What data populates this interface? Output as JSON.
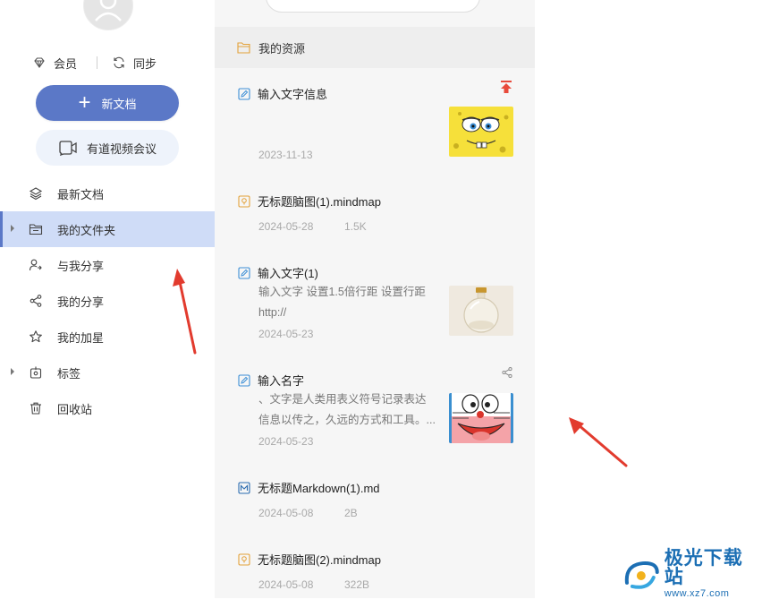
{
  "sidebar": {
    "member_label": "会员",
    "sync_label": "同步",
    "new_doc_label": "新文档",
    "meeting_label": "有道视频会议",
    "nav": {
      "latest": "最新文档",
      "my_folder": "我的文件夹",
      "shared_with_me": "与我分享",
      "my_shares": "我的分享",
      "starred": "我的加星",
      "tags": "标签",
      "trash": "回收站"
    }
  },
  "list": {
    "folder_title": "我的资源",
    "items": [
      {
        "title": "输入文字信息",
        "date": "2023-11-13",
        "type": "note",
        "pinned": true
      },
      {
        "title": "无标题脑图(1).mindmap",
        "date": "2024-05-28",
        "size": "1.5K",
        "type": "mindmap"
      },
      {
        "title": "输入文字(1)",
        "snippet1": "输入文字 设置1.5倍行距 设置行距",
        "snippet2": "http://",
        "date": "2024-05-23",
        "type": "note"
      },
      {
        "title": "输入名字",
        "snippet1": "、文字是人类用表义符号记录表达",
        "snippet2": "信息以传之，久远的方式和工具。...",
        "date": "2024-05-23",
        "type": "note",
        "shared": true
      },
      {
        "title": "无标题Markdown(1).md",
        "date": "2024-05-08",
        "size": "2B",
        "type": "markdown"
      },
      {
        "title": "无标题脑图(2).mindmap",
        "date": "2024-05-08",
        "size": "322B",
        "type": "mindmap"
      }
    ]
  },
  "watermark": {
    "name": "极光下载站",
    "url": "www.xz7.com"
  },
  "colors": {
    "accent": "#5b78c7",
    "active_bg": "#cfdcf7",
    "panel_bg": "#f6f6f6",
    "arrow": "#e23b2e",
    "pin": "#e84a3b"
  }
}
